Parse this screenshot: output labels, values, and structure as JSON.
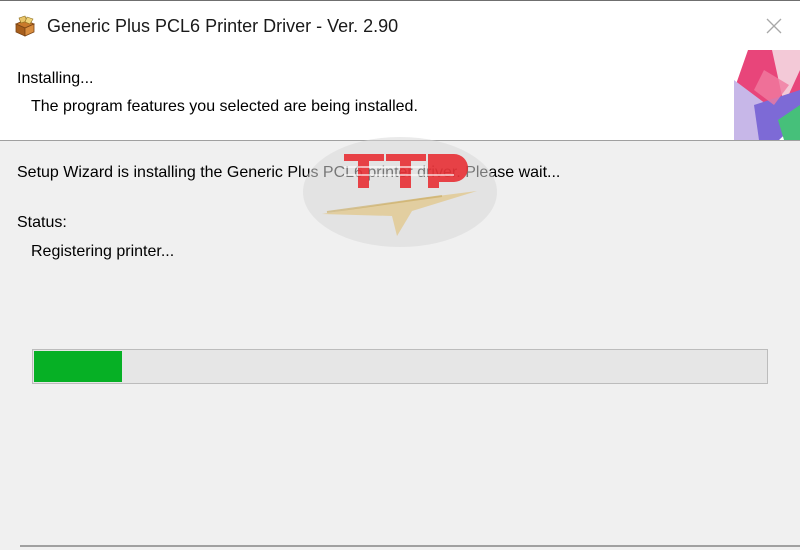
{
  "window": {
    "title": "Generic Plus PCL6 Printer Driver - Ver. 2.90",
    "close_icon": "close-icon"
  },
  "header": {
    "title": "Installing...",
    "subtitle": "The program features you selected are being installed."
  },
  "body": {
    "message": "Setup Wizard is installing the Generic Plus PCL6 printer driver. Please wait...",
    "status_label": "Status:",
    "status_value": "Registering printer..."
  },
  "progress": {
    "value_percent": 12,
    "color": "#06b025"
  },
  "watermark": {
    "text": "TTP",
    "color": "#e8252b"
  }
}
